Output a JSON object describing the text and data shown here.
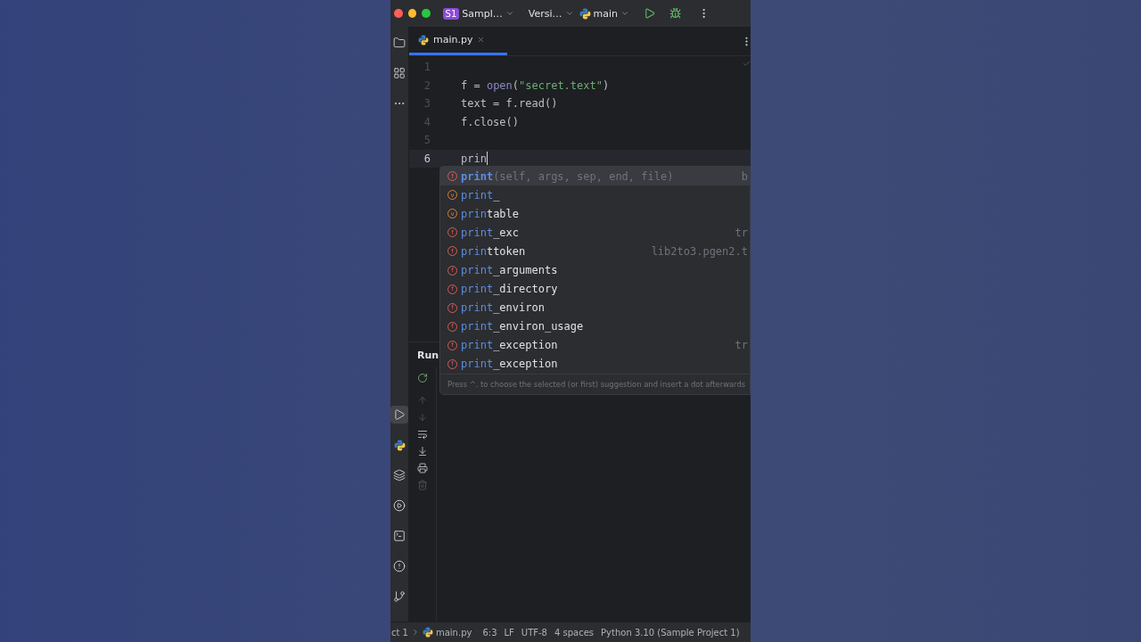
{
  "title_bar": {
    "project_badge": "S1",
    "project": "Sampl…",
    "vcs": "Versi…",
    "run_config": "main"
  },
  "left_toolbar": {
    "top": [
      {
        "kind": "folder",
        "selected": false
      },
      {
        "kind": "structure",
        "selected": false
      },
      {
        "kind": "more",
        "selected": false
      }
    ],
    "bottom": [
      {
        "kind": "run",
        "selected": true
      },
      {
        "kind": "python",
        "selected": false
      },
      {
        "kind": "layers",
        "selected": false
      },
      {
        "kind": "services",
        "selected": false
      },
      {
        "kind": "terminal",
        "selected": false
      },
      {
        "kind": "problems",
        "selected": false
      },
      {
        "kind": "git",
        "selected": false
      }
    ]
  },
  "editor_tabs": [
    {
      "label": "main.py",
      "selected": true
    }
  ],
  "editor": {
    "lines": [
      {
        "number": "1",
        "current": false
      },
      {
        "number": "2",
        "current": false,
        "tokens": [
          {
            "kind": "plain",
            "text": "f = "
          },
          {
            "kind": "builtin",
            "text": "open"
          },
          {
            "kind": "plain",
            "text": "("
          },
          {
            "kind": "string",
            "text": "\"secret.text\""
          },
          {
            "kind": "plain",
            "text": ")"
          }
        ]
      },
      {
        "number": "3",
        "current": false,
        "tokens": [
          {
            "kind": "plain",
            "text": "text = f.read()"
          }
        ]
      },
      {
        "number": "4",
        "current": false,
        "tokens": [
          {
            "kind": "plain",
            "text": "f.close()"
          }
        ]
      },
      {
        "number": "5",
        "current": false
      },
      {
        "number": "6",
        "current": true,
        "tokens": [
          {
            "kind": "plain",
            "text": "prin"
          }
        ]
      }
    ]
  },
  "completion": {
    "items": [
      {
        "kind": "function",
        "badge": "f",
        "match": "print",
        "params": "(self, args, sep, end, file)",
        "hint": "b",
        "selected": true
      },
      {
        "kind": "variable",
        "badge": "v",
        "match": "print",
        "rest": "_",
        "selected": false
      },
      {
        "kind": "variable",
        "badge": "v",
        "match": "prin",
        "rest": "table",
        "selected": false
      },
      {
        "kind": "function",
        "badge": "f",
        "match": "print",
        "rest": "_exc",
        "hint": "tr",
        "selected": false
      },
      {
        "kind": "function",
        "badge": "f",
        "match": "prin",
        "rest": "ttoken",
        "hint": "lib2to3.pgen2.t",
        "selected": false
      },
      {
        "kind": "function",
        "badge": "f",
        "match": "print",
        "rest": "_arguments",
        "selected": false
      },
      {
        "kind": "function",
        "badge": "f",
        "match": "print",
        "rest": "_directory",
        "selected": false
      },
      {
        "kind": "function",
        "badge": "f",
        "match": "print",
        "rest": "_environ",
        "selected": false
      },
      {
        "kind": "function",
        "badge": "f",
        "match": "print",
        "rest": "_environ_usage",
        "selected": false
      },
      {
        "kind": "function",
        "badge": "f",
        "match": "print",
        "rest": "_exception",
        "hint": "tr",
        "selected": false
      },
      {
        "kind": "function",
        "badge": "f",
        "match": "print",
        "rest": "_exception",
        "selected": false
      }
    ],
    "footer": "Press ^. to choose the selected (or first) suggestion and insert a dot afterwards"
  },
  "run_panel": {
    "title": "Run",
    "tools": [
      {
        "kind": "rerun",
        "disabled": false
      },
      {
        "kind": "up",
        "disabled": true
      },
      {
        "kind": "down",
        "disabled": true
      },
      {
        "kind": "wrap",
        "disabled": false
      },
      {
        "kind": "scroll-end",
        "disabled": false
      },
      {
        "kind": "print",
        "disabled": false
      },
      {
        "kind": "trash",
        "disabled": true
      }
    ]
  },
  "status_bar": {
    "breadcrumb": [
      "ct 1",
      "main.py"
    ],
    "items": [
      "6:3",
      "LF",
      "UTF-8",
      "4 spaces",
      "Python 3.10 (Sample Project 1)"
    ]
  }
}
